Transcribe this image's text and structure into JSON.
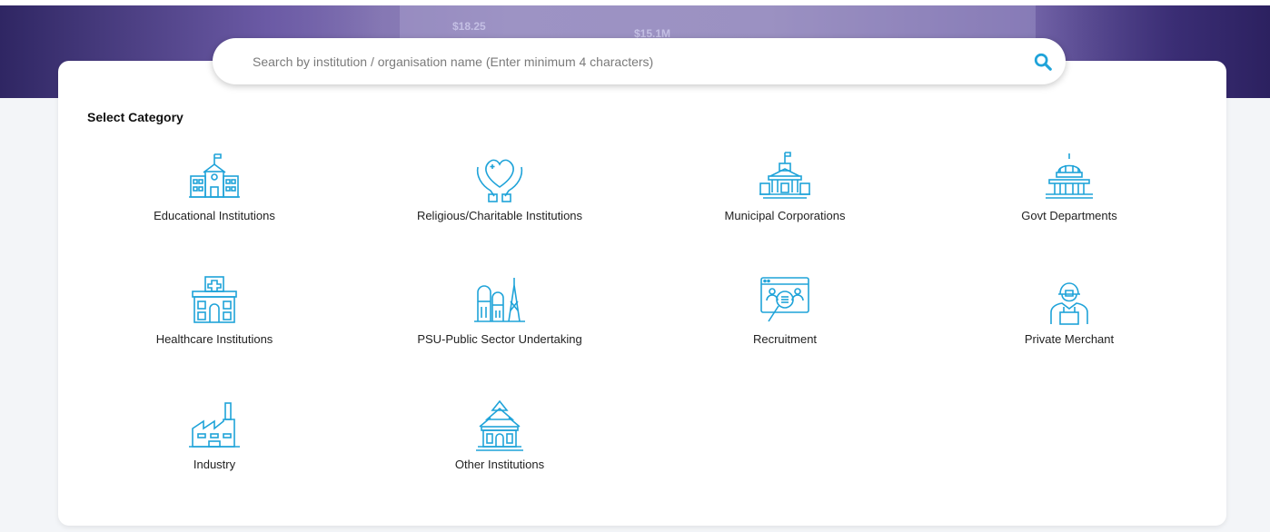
{
  "banner": {
    "metric_a": "$18.25",
    "metric_b": "$15.1M"
  },
  "search": {
    "placeholder": "Search by institution / organisation name (Enter minimum 4 characters)",
    "value": ""
  },
  "section_title": "Select Category",
  "accent_color": "#1fa3d9",
  "categories": [
    {
      "label": "Educational Institutions",
      "icon": "school-icon"
    },
    {
      "label": "Religious/Charitable Institutions",
      "icon": "heart-hands-icon"
    },
    {
      "label": "Municipal Corporations",
      "icon": "municipal-building-icon"
    },
    {
      "label": "Govt Departments",
      "icon": "capitol-dome-icon"
    },
    {
      "label": "Healthcare Institutions",
      "icon": "hospital-icon"
    },
    {
      "label": "PSU-Public Sector Undertaking",
      "icon": "oil-refinery-icon"
    },
    {
      "label": "Recruitment",
      "icon": "recruitment-search-icon"
    },
    {
      "label": "Private Merchant",
      "icon": "merchant-person-icon"
    },
    {
      "label": "Industry",
      "icon": "factory-icon"
    },
    {
      "label": "Other Institutions",
      "icon": "temple-icon"
    }
  ]
}
